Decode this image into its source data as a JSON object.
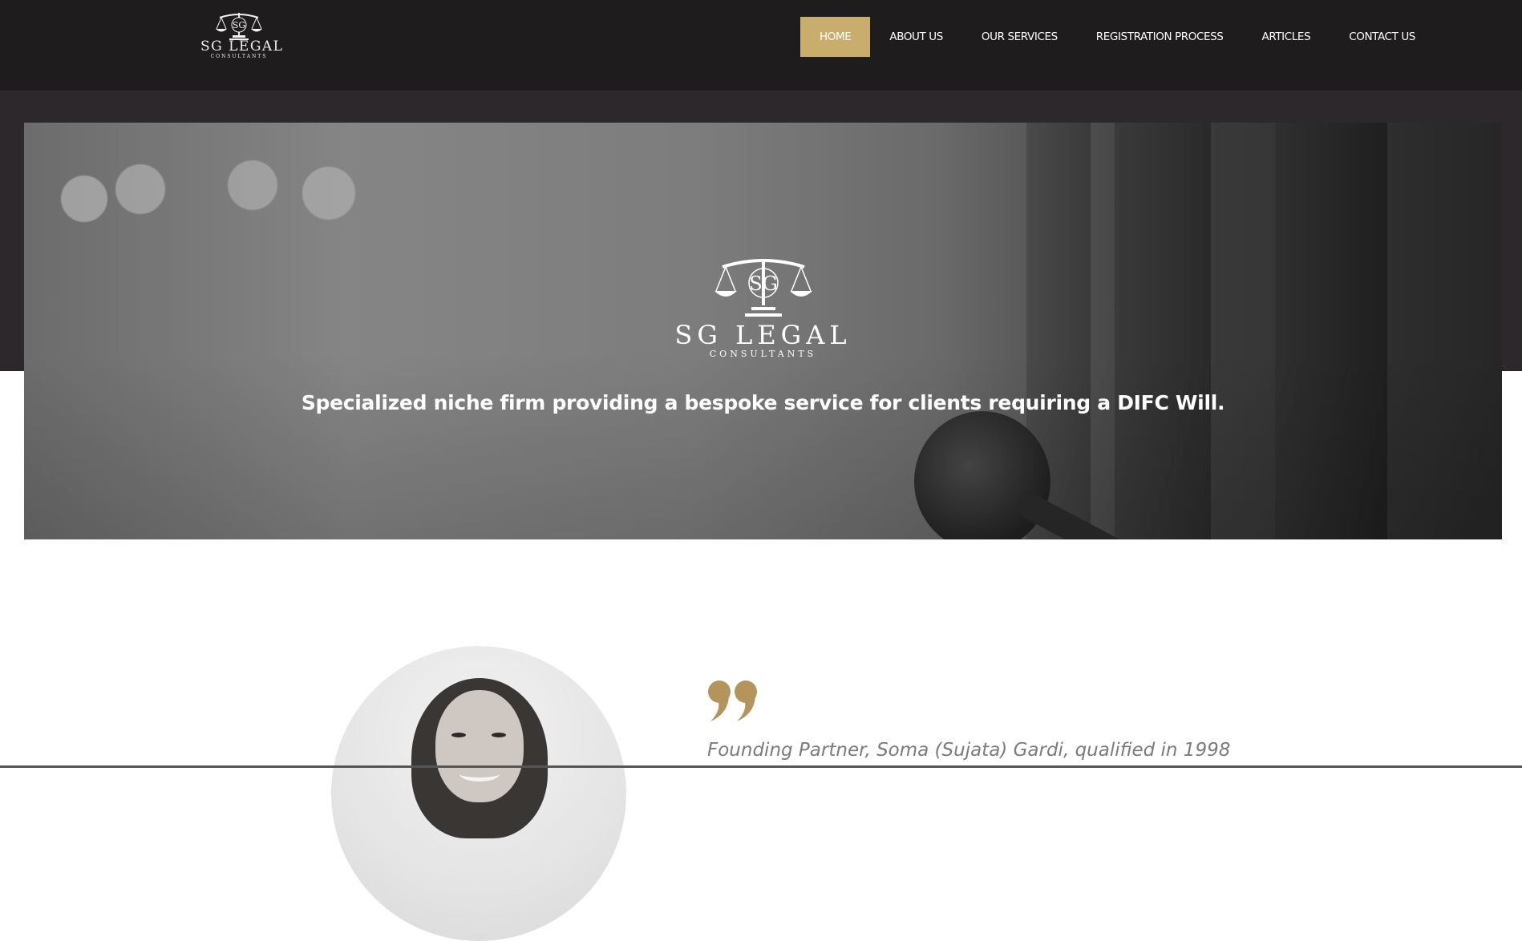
{
  "header": {
    "logo": {
      "brand": "SG LEGAL",
      "sub": "CONSULTANTS",
      "monogram": "SG"
    },
    "nav": [
      {
        "label": "HOME",
        "active": true
      },
      {
        "label": "ABOUT US",
        "active": false
      },
      {
        "label": "OUR SERVICES",
        "active": false
      },
      {
        "label": "REGISTRATION PROCESS",
        "active": false
      },
      {
        "label": "ARTICLES",
        "active": false
      },
      {
        "label": "CONTACT US",
        "active": false
      }
    ]
  },
  "hero": {
    "logo": {
      "brand": "SG LEGAL",
      "sub": "CONSULTANTS",
      "monogram": "SG",
      "icon": "scales-of-justice-icon"
    },
    "tagline": "Specialized niche firm providing a bespoke service for clients requiring a DIFC Will."
  },
  "testimonial": {
    "quote_icon": "quote-mark-icon",
    "text": "Founding Partner, Soma (Sujata) Gardi, qualified in 1998"
  },
  "colors": {
    "nav_bg": "#1f1c1e",
    "accent": "#c9ad6c",
    "band": "#2c282b",
    "quote": "#b3955c",
    "body_text": "#7b7b7b"
  }
}
